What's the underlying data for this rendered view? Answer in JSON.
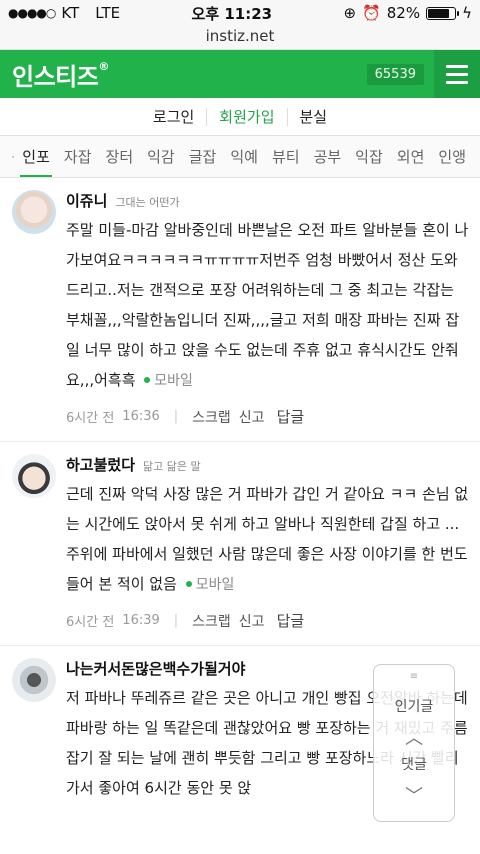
{
  "status": {
    "carrier": "KT",
    "network": "LTE",
    "time": "오후 11:23",
    "battery": "82%",
    "battery_level": 0.82
  },
  "url": "instiz.net",
  "header": {
    "logo": "인스티즈",
    "logo_mark": "®",
    "count": "65539"
  },
  "auth": {
    "login": "로그인",
    "signup": "회원가입",
    "lost": "분실"
  },
  "tabs": [
    "인포",
    "자잡",
    "장터",
    "익감",
    "글잡",
    "익예",
    "뷰티",
    "공부",
    "익잡",
    "외연",
    "인앵"
  ],
  "comments": [
    {
      "badge": "5",
      "name": "이쥬니",
      "tag": "그대는 어떤가",
      "text": "주말 미들-마감 알바중인데 바쁜날은 오전 파트 알바분들 혼이 나가보여요ㅋㅋㅋㅋㅋㅋㅠㅠㅠㅠ저번주 엄청 바빴어서 정산 도와드리고..저는 갠적으로 포장 어려워하는데 그 중 최고는 각잡는 부채꼴,,,악랄한놈입니더 진짜,,,,글고 저희 매장 파바는 진짜 잡일 너무 많이 하고 앉을 수도 없는데 주휴 없고 휴식시간도 안줘요,,,어흑흑",
      "mobile": "모바일",
      "time": "6시간 전",
      "clock": "16:36",
      "scrap": "스크랩",
      "report": "신고",
      "reply": "답글"
    },
    {
      "badge": "6",
      "name": "하고불렀다",
      "tag": "닮고 닮은 말",
      "text": "근데 진짜 악덕 사장 많은 거 파바가 갑인 거 같아요 ㅋㅋ 손님 없는 시간에도 앉아서 못 쉬게 하고 알바나 직원한테 갑질 하고 ... 주위에 파바에서 일했던 사람 많은데 좋은 사장 이야기를 한 번도 들어 본 적이 없음",
      "mobile": "모바일",
      "time": "6시간 전",
      "clock": "16:39",
      "scrap": "스크랩",
      "report": "신고",
      "reply": "답글"
    },
    {
      "badge": "8",
      "name": "나는커서돈많은백수가될거야",
      "tag": "",
      "text": "저 파바나 뚜레쥬르 같은 곳은 아니고 개인 빵집 오전알바 하는데 파바랑 하는 일 똑같은데 괜찮았어요 빵 포장하는 거 재밌고 주름잡기 잘 되는 날에 괜히 뿌듯함 그리고 빵 포장하느라 시간 빨리 가서 좋아여 6시간 동안 못 앉"
    }
  ],
  "float": {
    "popular": "인기글",
    "comment": "댓글"
  }
}
